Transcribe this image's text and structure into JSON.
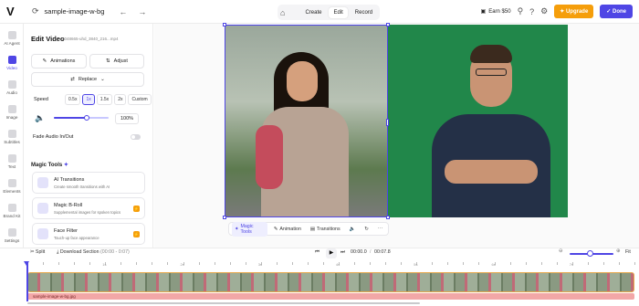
{
  "app": {
    "logo_text": "V",
    "file_name": "sample-image-w-bg"
  },
  "top_modes": [
    {
      "label": "Create",
      "active": false
    },
    {
      "label": "Edit",
      "active": true
    },
    {
      "label": "Record",
      "active": false
    }
  ],
  "topbar_right": {
    "earn_label": "Earn $50",
    "upgrade_label": "Upgrade",
    "done_label": "Done"
  },
  "rail": [
    {
      "label": "AI Agent",
      "icon": "sparkle-icon"
    },
    {
      "label": "Video",
      "icon": "video-icon",
      "active": true
    },
    {
      "label": "Audio",
      "icon": "audio-icon"
    },
    {
      "label": "Image",
      "icon": "image-icon"
    },
    {
      "label": "Subtitles",
      "icon": "subtitles-icon"
    },
    {
      "label": "Text",
      "icon": "text-icon"
    },
    {
      "label": "Elements",
      "icon": "elements-icon"
    },
    {
      "label": "Brand Kit",
      "icon": "brand-kit-icon"
    },
    {
      "label": "Settings",
      "icon": "gear-icon"
    }
  ],
  "panel": {
    "title": "Edit Video",
    "file_id": "2048665-uhd_3840_216...mp4",
    "animations_label": "Animations",
    "adjust_label": "Adjust",
    "replace_label": "Replace",
    "speed_label": "Speed",
    "speed_options": [
      "0.5x",
      "1x",
      "1.5x",
      "2x",
      "Custom"
    ],
    "speed_selected": "1x",
    "volume_value": "100%",
    "volume_fraction": 1.0,
    "fade_label": "Fade Audio In/Out",
    "fade_on": false,
    "magic_tools_title": "Magic Tools",
    "tools": [
      {
        "title": "AI Transitions",
        "subtitle": "Create smooth transitions with AI",
        "premium": false
      },
      {
        "title": "Magic B-Roll",
        "subtitle": "Supplemental images for spoken topics",
        "premium": true
      },
      {
        "title": "Face Filter",
        "subtitle": "Touch-up face appearance",
        "premium": true
      }
    ]
  },
  "canvas_toolbar": [
    {
      "label": "Magic Tools",
      "active": true
    },
    {
      "label": "Animation",
      "active": false
    },
    {
      "label": "Transitions",
      "active": false
    }
  ],
  "timeline": {
    "split_label": "Split",
    "download_label": "Download Section",
    "range_label": "(00:00 - 0:07)",
    "current_time": "00:00.0",
    "separator": "/",
    "total_time": "00:07.8",
    "fit_label": "Fit",
    "zoom_fraction": 0.45,
    "ruler_labels": [
      "1s",
      "2s",
      "3s",
      "4s",
      "5s",
      "6s",
      "7s"
    ],
    "audio_track_label": "sample-image-w-bg.jpg"
  },
  "colors": {
    "accent": "#4f46e5",
    "upgrade": "#f59e0b",
    "clip_border": "#e6a84b",
    "audio_track": "#f2a7a7"
  }
}
